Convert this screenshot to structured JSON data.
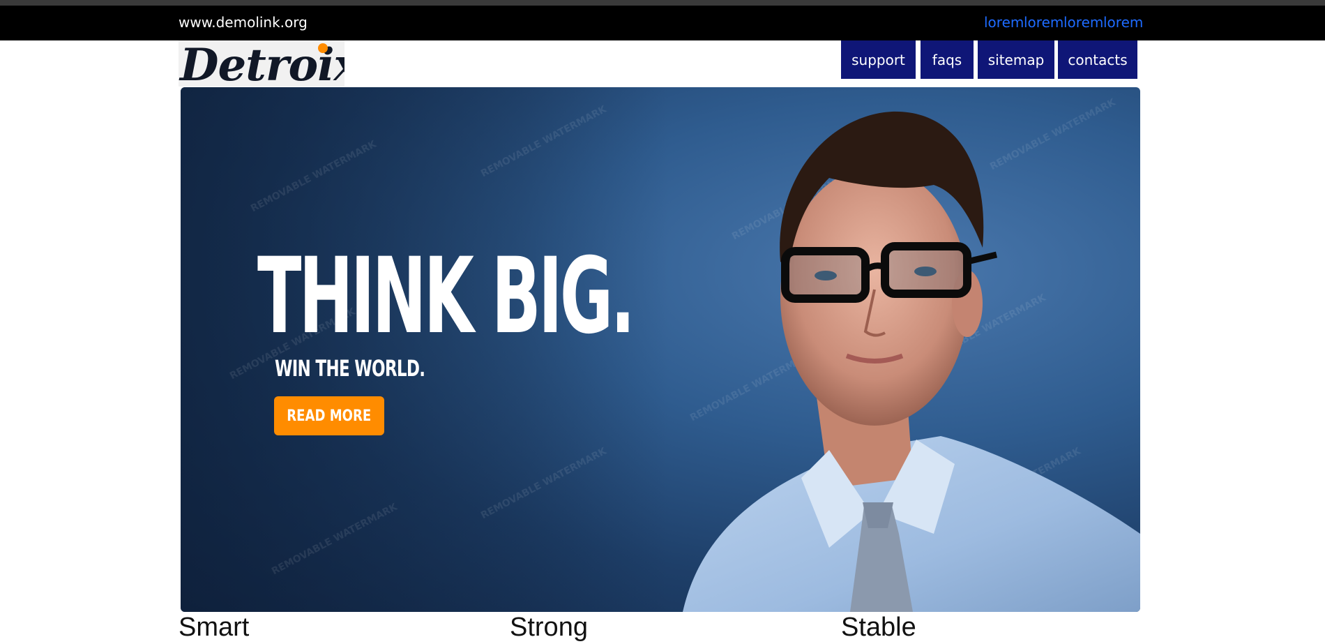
{
  "header": {
    "site_url": "www.demolink.org",
    "top_links": [
      "lorem",
      "lorem",
      "lorem",
      "lorem"
    ],
    "link_color": "#1e6bff",
    "bar_color": "#000000"
  },
  "logo": {
    "text": "Detroix",
    "dot_color": "#ff8c00"
  },
  "nav": {
    "items": [
      "support",
      "faqs",
      "sitemap",
      "contacts"
    ],
    "bg_color": "#0f1677"
  },
  "hero": {
    "headline": "THINK BIG.",
    "subline": "WIN THE WORLD.",
    "button_label": "READ MORE",
    "button_color": "#ff8c00",
    "watermark_text": "REMOVABLE WATERMARK"
  },
  "features": {
    "titles": [
      "Smart",
      "Strong",
      "Stable"
    ]
  }
}
